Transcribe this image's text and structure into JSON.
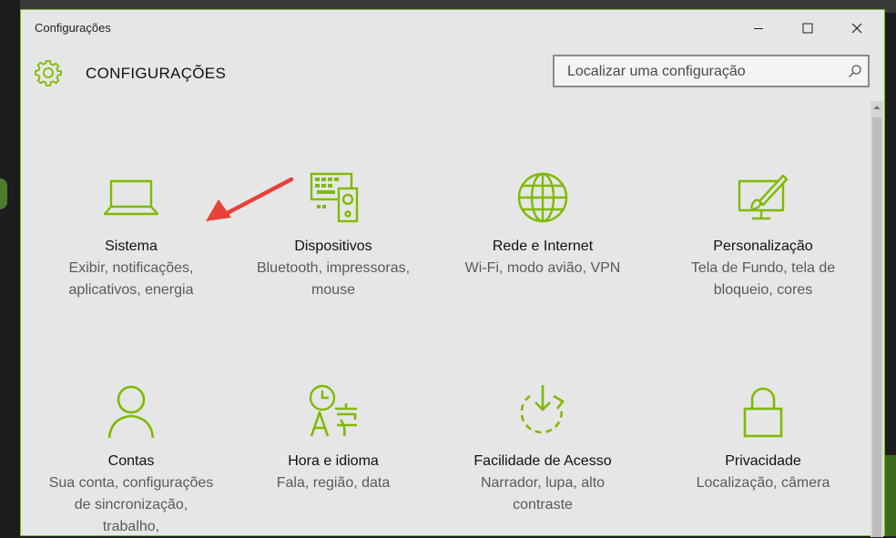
{
  "window": {
    "title": "Configurações",
    "header_title": "CONFIGURAÇÕES"
  },
  "search": {
    "placeholder": "Localizar uma configuração"
  },
  "colors": {
    "accent": "#7fba00",
    "annotation_arrow": "#e8403a",
    "window_border": "#7cb342"
  },
  "tiles": [
    {
      "icon": "laptop-icon",
      "name": "Sistema",
      "desc": "Exibir, notificações, aplicativos, energia"
    },
    {
      "icon": "devices-icon",
      "name": "Dispositivos",
      "desc": "Bluetooth, impressoras, mouse"
    },
    {
      "icon": "globe-icon",
      "name": "Rede e Internet",
      "desc": "Wi-Fi, modo avião, VPN"
    },
    {
      "icon": "personalization-icon",
      "name": "Personalização",
      "desc": "Tela de Fundo, tela de bloqueio, cores"
    },
    {
      "icon": "person-icon",
      "name": "Contas",
      "desc": "Sua conta, configurações de sincronização, trabalho,"
    },
    {
      "icon": "time-language-icon",
      "name": "Hora e idioma",
      "desc": "Fala, região, data"
    },
    {
      "icon": "ease-of-access-icon",
      "name": "Facilidade de Acesso",
      "desc": "Narrador, lupa, alto contraste"
    },
    {
      "icon": "lock-icon",
      "name": "Privacidade",
      "desc": "Localização, câmera"
    }
  ]
}
